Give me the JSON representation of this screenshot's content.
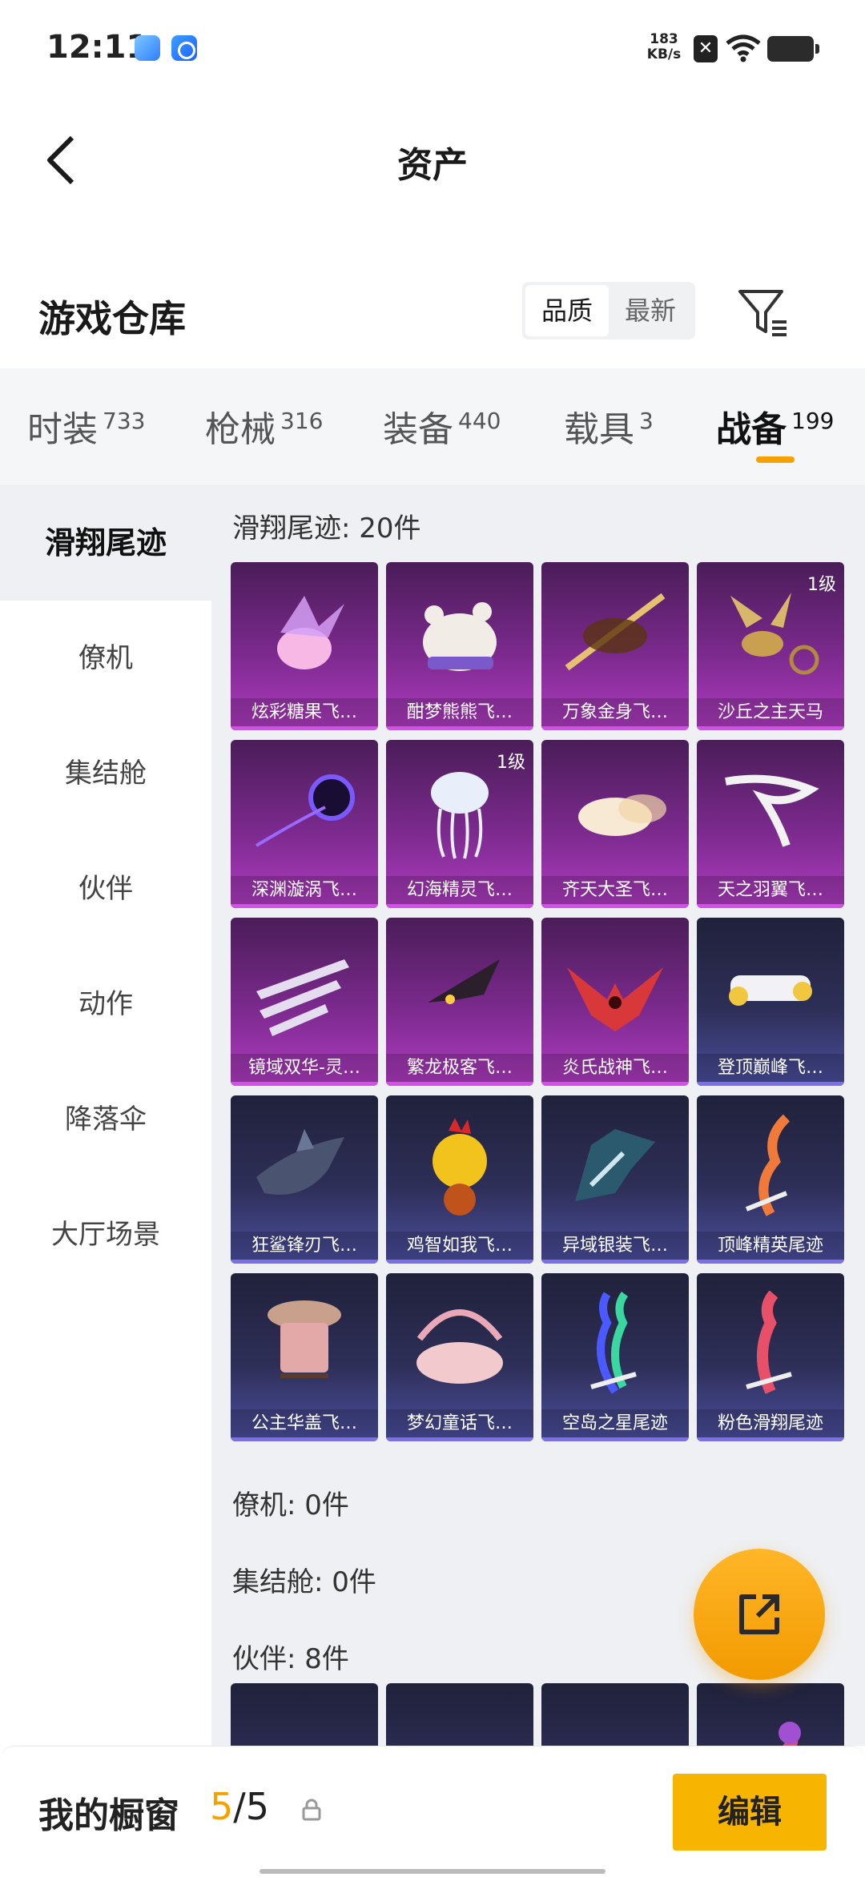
{
  "status": {
    "time": "12:11",
    "speed_value": "183",
    "speed_unit": "KB/s"
  },
  "header": {
    "title": "资产"
  },
  "warehouse": {
    "title": "游戏仓库",
    "sort_options": [
      "品质",
      "最新"
    ],
    "sort_selected": "品质"
  },
  "tabs": [
    {
      "label": "时装",
      "count": "733"
    },
    {
      "label": "枪械",
      "count": "316"
    },
    {
      "label": "装备",
      "count": "440"
    },
    {
      "label": "载具",
      "count": "3"
    },
    {
      "label": "战备",
      "count": "199",
      "active": true
    }
  ],
  "sidebar": {
    "items": [
      "滑翔尾迹",
      "僚机",
      "集结舱",
      "伙伴",
      "动作",
      "降落伞",
      "大厅场景"
    ],
    "active": "滑翔尾迹"
  },
  "sections": {
    "glide": {
      "label": "滑翔尾迹: 20件",
      "items": [
        {
          "name": "炫彩糖果飞…",
          "rarity": "purple",
          "art": "candy-icon"
        },
        {
          "name": "酣梦熊熊飞…",
          "rarity": "purple",
          "art": "bear-icon"
        },
        {
          "name": "万象金身飞…",
          "rarity": "purple",
          "art": "golden-staff-icon"
        },
        {
          "name": "沙丘之主天马",
          "rarity": "purple",
          "art": "pegasus-icon",
          "level": "1级"
        },
        {
          "name": "深渊漩涡飞…",
          "rarity": "purple",
          "art": "vortex-icon"
        },
        {
          "name": "幻海精灵飞…",
          "rarity": "purple",
          "art": "jellyfish-icon",
          "level": "1级"
        },
        {
          "name": "齐天大圣飞…",
          "rarity": "purple",
          "art": "cloud-icon"
        },
        {
          "name": "天之羽翼飞…",
          "rarity": "purple",
          "art": "feather-wing-icon"
        },
        {
          "name": "镜域双华-灵…",
          "rarity": "purple",
          "art": "crystal-icon"
        },
        {
          "name": "繁龙极客飞…",
          "rarity": "purple",
          "art": "dragon-icon"
        },
        {
          "name": "炎氏战神飞…",
          "rarity": "purple",
          "art": "flame-wing-icon"
        },
        {
          "name": "登顶巅峰飞…",
          "rarity": "blue",
          "art": "jet-icon"
        },
        {
          "name": "狂鲨锋刃飞…",
          "rarity": "blue",
          "art": "shark-icon"
        },
        {
          "name": "鸡智如我飞…",
          "rarity": "blue",
          "art": "chicken-icon"
        },
        {
          "name": "异域银装飞…",
          "rarity": "blue",
          "art": "silver-wing-icon"
        },
        {
          "name": "顶峰精英尾迹",
          "rarity": "blue",
          "art": "trail-fire-icon"
        },
        {
          "name": "公主华盖飞…",
          "rarity": "blue",
          "art": "canopy-icon"
        },
        {
          "name": "梦幻童话飞…",
          "rarity": "blue",
          "art": "carriage-icon"
        },
        {
          "name": "空岛之星尾迹",
          "rarity": "blue",
          "art": "trail-rainbow-icon"
        },
        {
          "name": "粉色滑翔尾迹",
          "rarity": "blue",
          "art": "trail-pink-icon"
        }
      ]
    },
    "wingman": {
      "label": "僚机: 0件"
    },
    "pod": {
      "label": "集结舱: 0件"
    },
    "partner": {
      "label": "伙伴: 8件",
      "items": [
        {
          "art": "shiba-icon"
        },
        {
          "art": "granny-icon"
        },
        {
          "art": "doll-icon"
        },
        {
          "art": "pink-dragon-icon"
        }
      ]
    }
  },
  "showcase": {
    "label": "我的橱窗",
    "current": "5",
    "total": "/5",
    "edit_label": "编辑"
  },
  "colors": {
    "accent": "#f5a100",
    "purple_rarity": "#b03cc2",
    "blue_rarity": "#4c4fa0"
  }
}
